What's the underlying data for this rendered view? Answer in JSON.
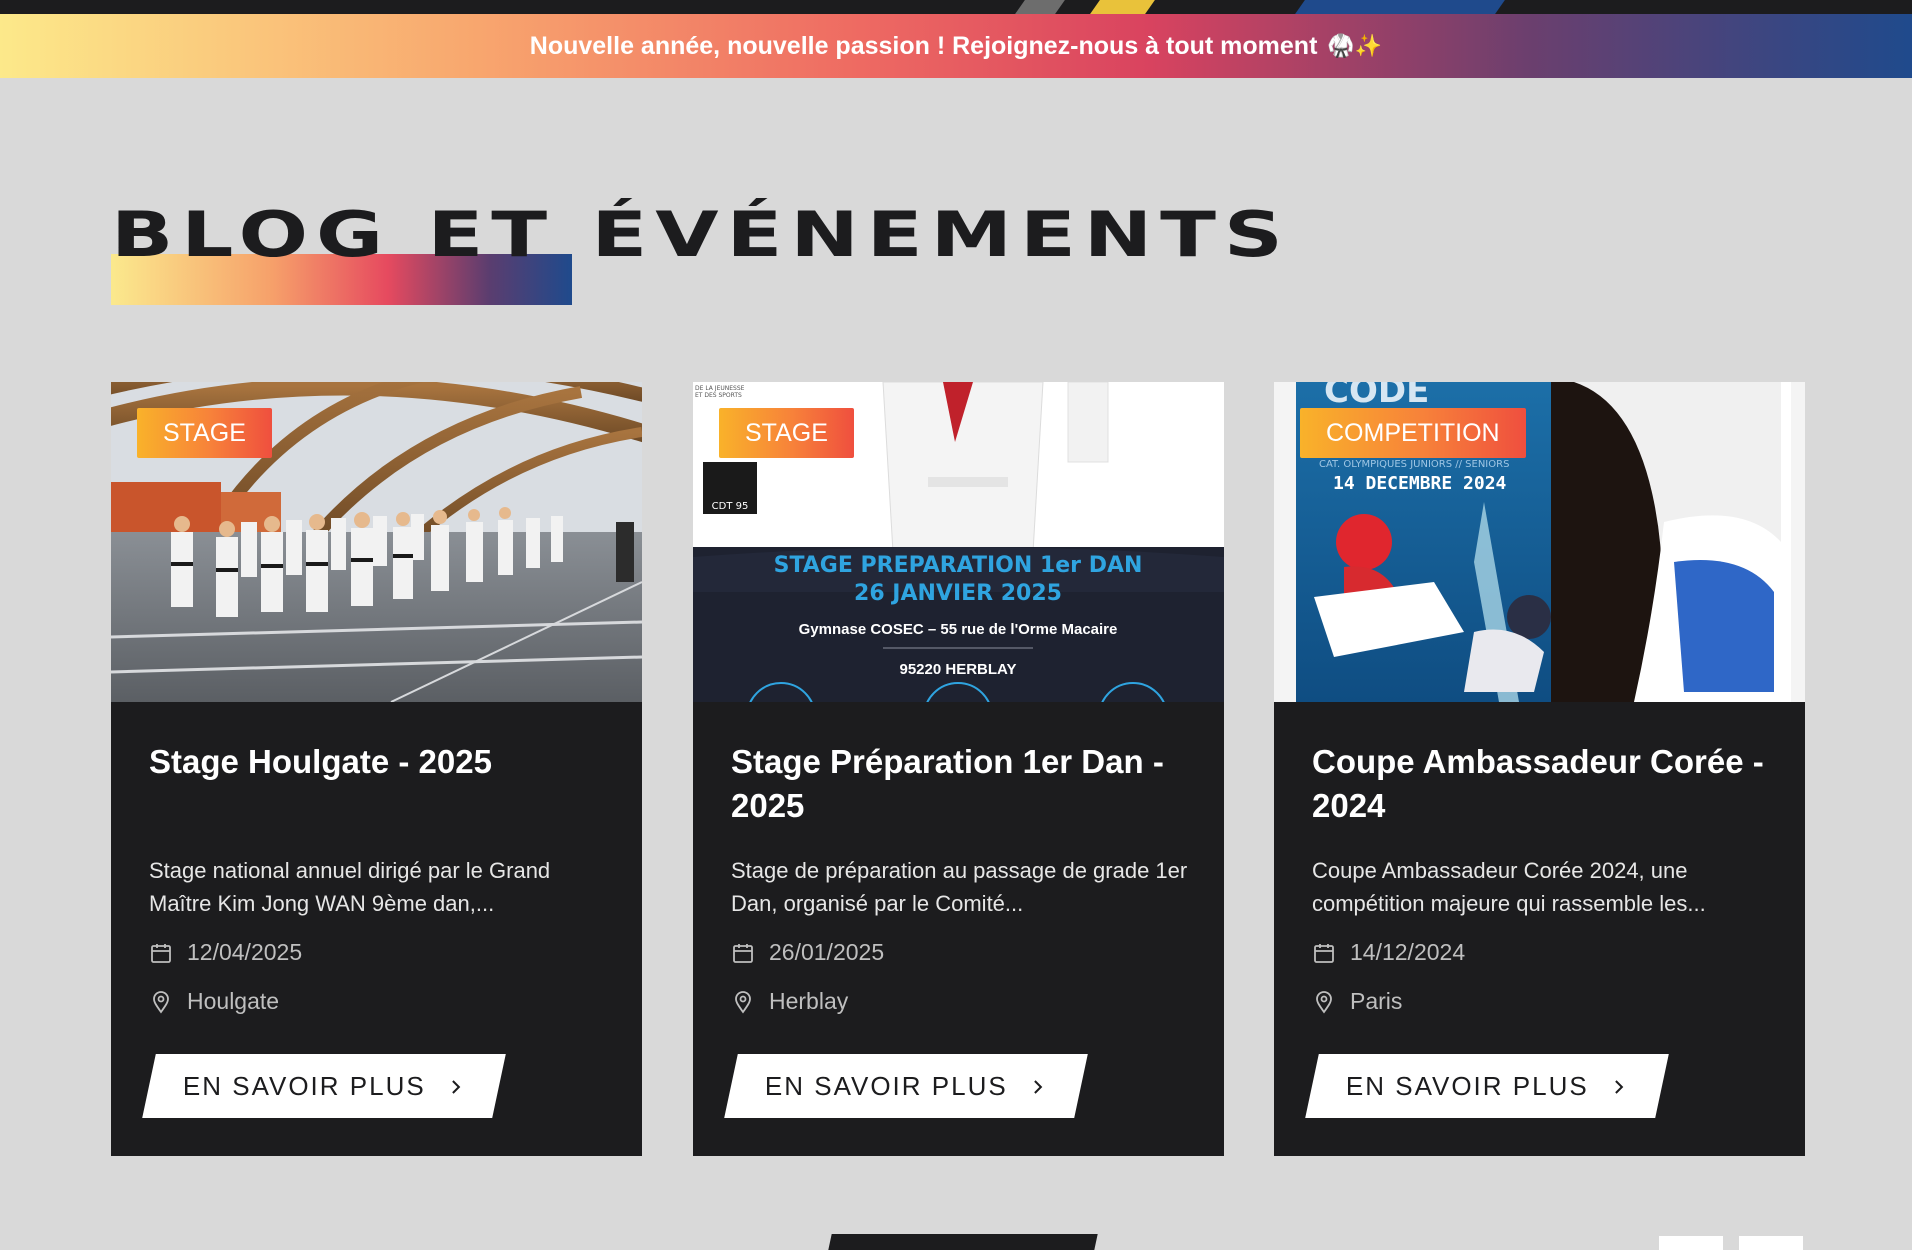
{
  "announcement": {
    "text": "Nouvelle année, nouvelle passion ! Rejoignez-nous à tout moment",
    "emoji": "🥋✨"
  },
  "section": {
    "title": "BLOG ET ÉVÉNEMENTS"
  },
  "colors": {
    "card_bg": "#1c1c1e",
    "page_bg": "#d9d9d9",
    "badge_start": "#f9b22a",
    "badge_end": "#ef4f3e"
  },
  "cards": [
    {
      "badge": "STAGE",
      "title": "Stage Houlgate - 2025",
      "excerpt": "Stage national annuel dirigé par le Grand Maître Kim Jong WAN 9ème dan,...",
      "date": "12/04/2025",
      "location": "Houlgate",
      "button": "EN SAVOIR PLUS",
      "image": "photo of a gymnasium with rows of taekwondo practitioners in white doboks"
    },
    {
      "badge": "STAGE",
      "title": "Stage Préparation 1er Dan - 2025",
      "excerpt": "Stage de préparation au passage de grade 1er Dan, organisé par le Comité...",
      "date": "26/01/2025",
      "location": "Herblay",
      "button": "EN SAVOIR PLUS",
      "poster": {
        "headline": "STAGE PREPARATION 1er DAN",
        "date": "26 JANVIER 2025",
        "venue": "Gymnase COSEC – 55 rue de l'Orme Macaire",
        "city": "95220 HERBLAY",
        "logo": "CDT 95",
        "org_small_1": "DE LA JEUNESSE",
        "org_small_2": "ET DES SPORTS"
      }
    },
    {
      "badge": "COMPETITION",
      "title": "Coupe Ambassadeur Corée - 2024",
      "excerpt": "Coupe Ambassadeur Corée 2024, une compétition majeure qui rassemble les...",
      "date": "14/12/2024",
      "location": "Paris",
      "button": "EN SAVOIR PLUS",
      "poster": {
        "subline": "CAT. OLYMPIQUES JUNIORS // SENIORS",
        "date": "14 DECEMBRE 2024"
      }
    }
  ]
}
